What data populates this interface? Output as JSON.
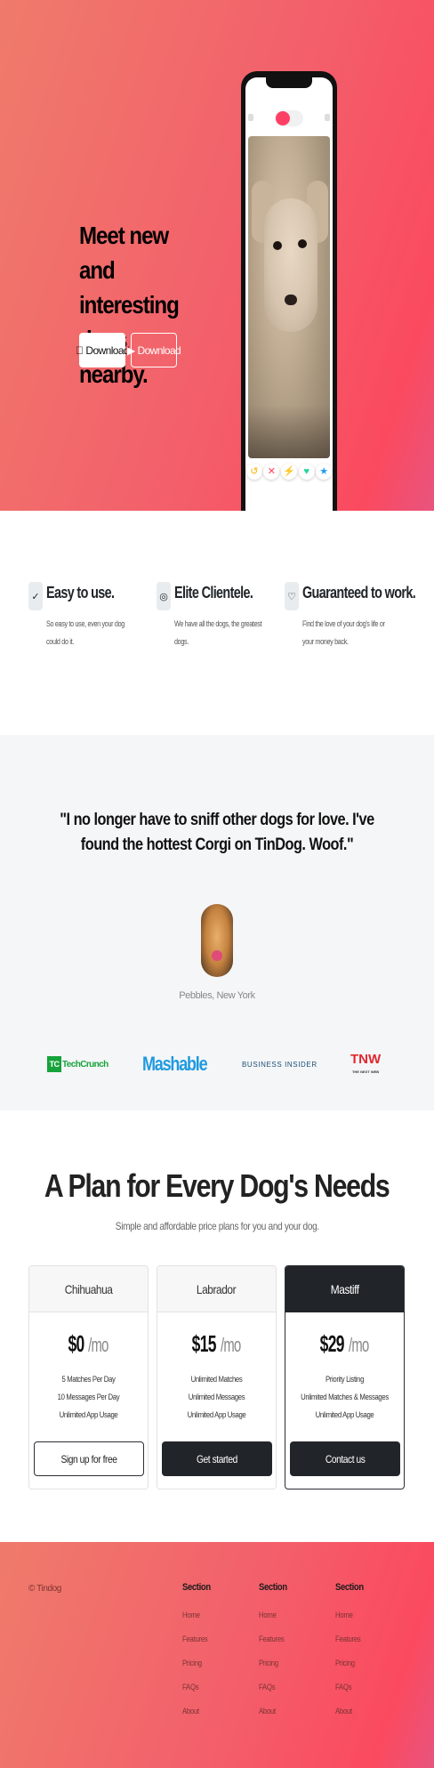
{
  "hero": {
    "title": "Meet new and interesting dogs nearby.",
    "download_apple_label": "Download",
    "download_play_label": "Download",
    "apple_icon": "apple-icon",
    "play_icon": "play-store-icon",
    "accent": "#fd3f66"
  },
  "features": [
    {
      "icon": "check-circle-icon",
      "title": "Easy to use.",
      "text": "So easy to use, even your dog could do it."
    },
    {
      "icon": "bullseye-icon",
      "title": "Elite Clientele.",
      "text": "We have all the dogs, the greatest dogs."
    },
    {
      "icon": "heart-icon",
      "title": "Guaranteed to work.",
      "text": "Find the love of your dog's life or your money back."
    }
  ],
  "testimonial": {
    "quote": "\"I no longer have to sniff other dogs for love. I've found the hottest Corgi on TinDog. Woof.\"",
    "author": "Pebbles, New York"
  },
  "press": {
    "techcrunch": "TechCrunch",
    "mashable": "Mashable",
    "business_insider": "BUSINESS INSIDER",
    "tnw": "TNW",
    "tnw_sub": "THE NEXT WEB"
  },
  "pricing": {
    "title": "A Plan for Every Dog's Needs",
    "subtitle": "Simple and affordable price plans for you and your dog.",
    "plans": [
      {
        "name": "Chihuahua",
        "price": "$0",
        "period": "/mo",
        "features": [
          "5 Matches Per Day",
          "10 Messages Per Day",
          "Unlimited App Usage"
        ],
        "button": "Sign up for free"
      },
      {
        "name": "Labrador",
        "price": "$15",
        "period": "/mo",
        "features": [
          "Unlimited Matches",
          "Unlimited Messages",
          "Unlimited App Usage"
        ],
        "button": "Get started"
      },
      {
        "name": "Mastiff",
        "price": "$29",
        "period": "/mo",
        "features": [
          "Priority Listing",
          "Unlimited Matches & Messages",
          "Unlimited App Usage"
        ],
        "button": "Contact us"
      }
    ]
  },
  "footer": {
    "copyright": "© Tindog",
    "columns": [
      {
        "heading": "Section",
        "links": [
          "Home",
          "Features",
          "Pricing",
          "FAQs",
          "About"
        ]
      },
      {
        "heading": "Section",
        "links": [
          "Home",
          "Features",
          "Pricing",
          "FAQs",
          "About"
        ]
      },
      {
        "heading": "Section",
        "links": [
          "Home",
          "Features",
          "Pricing",
          "FAQs",
          "About"
        ]
      }
    ]
  }
}
